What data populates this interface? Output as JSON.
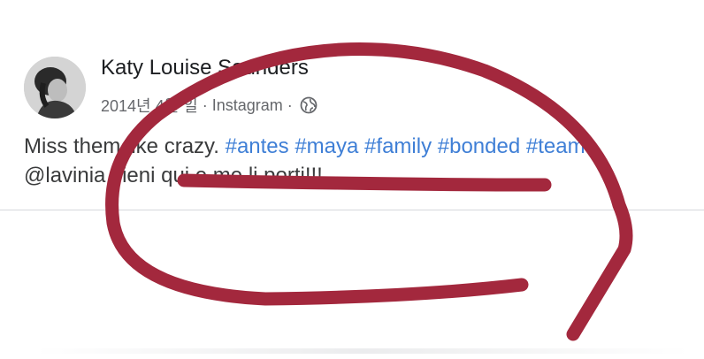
{
  "post": {
    "author": "Katy Louise Saunders",
    "date": "2014년 4월 일",
    "separator": "·",
    "source": "Instagram",
    "privacy_icon": "globe-icon",
    "text": {
      "line1_plain": "Miss them like crazy. ",
      "hashtags": [
        "#antes",
        "#maya",
        "#family",
        "#bonded",
        "#team"
      ],
      "line1_end": ".",
      "line2": "@lavinia vieni qui e me li porti!!!"
    }
  },
  "annotation": {
    "type": "hand-drawn circle with strike lines",
    "color": "#a3283d"
  }
}
